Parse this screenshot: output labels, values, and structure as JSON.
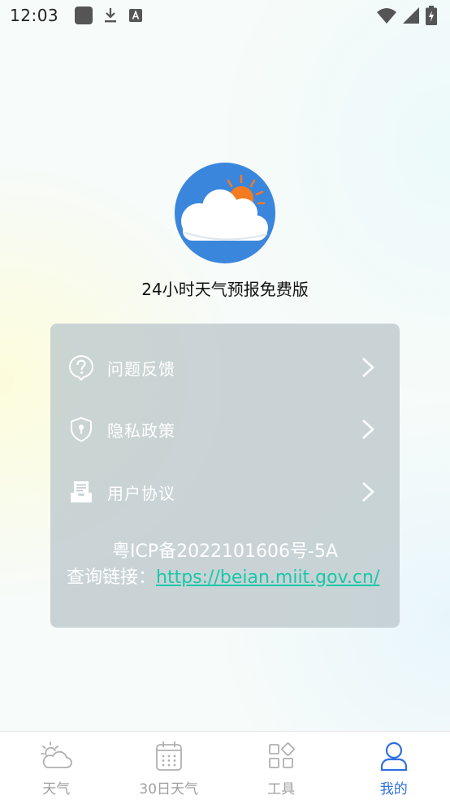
{
  "status_bar": {
    "time": "12:03",
    "notification_icons": [
      "square-app-icon",
      "download-icon",
      "keyboard-a-icon"
    ],
    "system_icons": [
      "wifi-icon",
      "signal-icon",
      "battery-charging-icon"
    ]
  },
  "app": {
    "logo_icon": "cloud-sun-icon",
    "name": "24小时天气预报免费版"
  },
  "menu": {
    "items": [
      {
        "icon": "question-bubble-icon",
        "label": "问题反馈"
      },
      {
        "icon": "shield-lock-icon",
        "label": "隐私政策"
      },
      {
        "icon": "document-tray-icon",
        "label": "用户协议"
      }
    ]
  },
  "footer_info": {
    "icp": "粤ICP备2022101606号-5A",
    "query_prefix": "查询链接：",
    "query_link": "https://beian.miit.gov.cn/"
  },
  "tab_bar": {
    "tabs": [
      {
        "label": "天气",
        "icon": "weather-cloud-sun-icon",
        "active": false
      },
      {
        "label": "30日天气",
        "icon": "calendar-icon",
        "active": false
      },
      {
        "label": "工具",
        "icon": "tools-grid-icon",
        "active": false
      },
      {
        "label": "我的",
        "icon": "user-profile-icon",
        "active": true
      }
    ]
  },
  "colors": {
    "accent": "#2f6fe0",
    "link": "#18c8a8",
    "logo_bg": "#3b86dd",
    "sun": "#f47b20",
    "inactive_tab": "#a0a0a0"
  }
}
